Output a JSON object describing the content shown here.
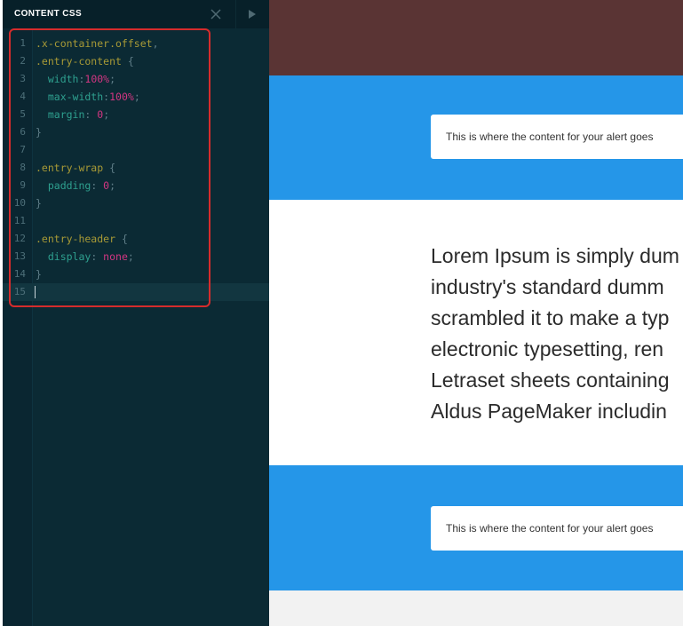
{
  "editor": {
    "title": "CONTENT CSS",
    "close_icon": "close-icon",
    "run_icon": "play-icon",
    "active_line": 15,
    "lines": [
      {
        "n": "1",
        "tokens": [
          {
            "t": ".x-container.offset",
            "c": "sel"
          },
          {
            "t": ",",
            "c": "punc"
          }
        ]
      },
      {
        "n": "2",
        "tokens": [
          {
            "t": ".entry-content",
            "c": "sel"
          },
          {
            "t": " {",
            "c": "punc"
          }
        ]
      },
      {
        "n": "3",
        "tokens": [
          {
            "t": "  width",
            "c": "prop"
          },
          {
            "t": ":",
            "c": "punc"
          },
          {
            "t": "100%",
            "c": "num"
          },
          {
            "t": ";",
            "c": "punc"
          }
        ]
      },
      {
        "n": "4",
        "tokens": [
          {
            "t": "  max-width",
            "c": "prop"
          },
          {
            "t": ":",
            "c": "punc"
          },
          {
            "t": "100%",
            "c": "num"
          },
          {
            "t": ";",
            "c": "punc"
          }
        ]
      },
      {
        "n": "5",
        "tokens": [
          {
            "t": "  margin",
            "c": "prop"
          },
          {
            "t": ": ",
            "c": "punc"
          },
          {
            "t": "0",
            "c": "num"
          },
          {
            "t": ";",
            "c": "punc"
          }
        ]
      },
      {
        "n": "6",
        "tokens": [
          {
            "t": "}",
            "c": "punc"
          }
        ]
      },
      {
        "n": "7",
        "tokens": []
      },
      {
        "n": "8",
        "tokens": [
          {
            "t": ".entry-wrap",
            "c": "sel"
          },
          {
            "t": " {",
            "c": "punc"
          }
        ]
      },
      {
        "n": "9",
        "tokens": [
          {
            "t": "  padding",
            "c": "prop"
          },
          {
            "t": ": ",
            "c": "punc"
          },
          {
            "t": "0",
            "c": "num"
          },
          {
            "t": ";",
            "c": "punc"
          }
        ]
      },
      {
        "n": "10",
        "tokens": [
          {
            "t": "}",
            "c": "punc"
          }
        ]
      },
      {
        "n": "11",
        "tokens": []
      },
      {
        "n": "12",
        "tokens": [
          {
            "t": ".entry-header",
            "c": "sel"
          },
          {
            "t": " {",
            "c": "punc"
          }
        ]
      },
      {
        "n": "13",
        "tokens": [
          {
            "t": "  display",
            "c": "prop"
          },
          {
            "t": ": ",
            "c": "punc"
          },
          {
            "t": "none",
            "c": "num"
          },
          {
            "t": ";",
            "c": "punc"
          }
        ]
      },
      {
        "n": "14",
        "tokens": [
          {
            "t": "}",
            "c": "punc"
          }
        ]
      },
      {
        "n": "15",
        "tokens": []
      }
    ]
  },
  "preview": {
    "alert_text": "This is where the content for your alert goes",
    "lorem_lines": [
      "Lorem Ipsum is simply dum",
      "industry's standard dumm",
      "scrambled it to make a typ",
      "electronic typesetting, ren",
      "Letraset sheets containing",
      "Aldus PageMaker includin"
    ]
  },
  "colors": {
    "editor_bg": "#0b2a34",
    "selector": "#a89a36",
    "property": "#2ea08f",
    "value": "#d33682",
    "hero": "#5a3434",
    "alert_band": "#2596e8",
    "highlight_box": "#d62c2c"
  }
}
